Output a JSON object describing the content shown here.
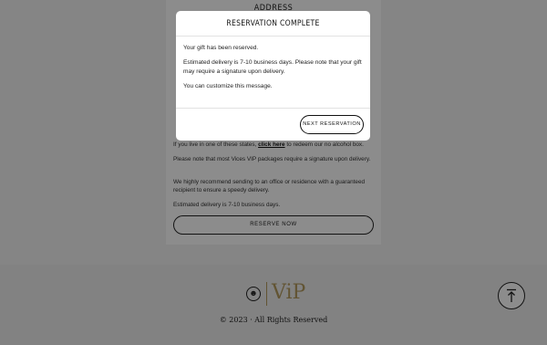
{
  "form": {
    "heading": "ADDRESS",
    "note_states_prefix": "If you live in one of these states, ",
    "note_states_link": "click here",
    "note_states_suffix": " to redeem our no alcohol box.",
    "note_signature": "Please note that most Vices VIP packages require a signature upon delivery.",
    "note_recommend": "We highly recommend sending to an office or residence with a guaranteed recipient to ensure a speedy delivery.",
    "note_estimate": "Estimated delivery is 7-10 business days.",
    "reserve_button": "RESERVE NOW"
  },
  "footer": {
    "logo_text": "ViP",
    "copyright": "© 2023 · All Rights Reserved",
    "back_to_top_icon": "arrow-up-icon"
  },
  "modal": {
    "title": "RESERVATION COMPLETE",
    "line1": "Your gift has been reserved.",
    "line2": "Estimated delivery is 7-10 business days. Please note that your gift may require a signature upon delivery.",
    "line3": "You can customize this message.",
    "next_button": "NEXT RESERVATION"
  }
}
